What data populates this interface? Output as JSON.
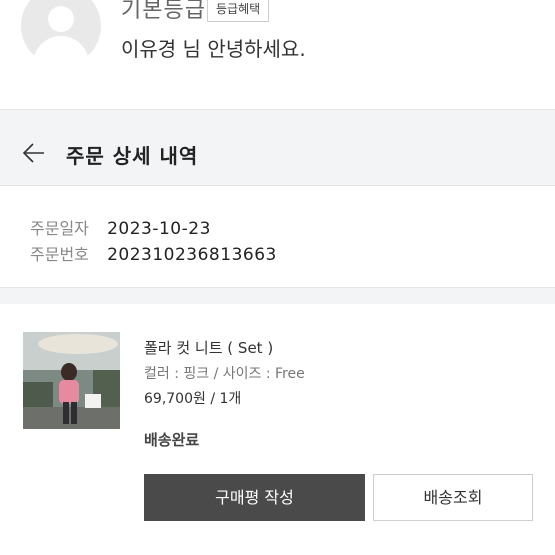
{
  "profile": {
    "grade_label": "기본등급",
    "grade_badge": "등급혜택",
    "greeting": "이유경 님 안녕하세요."
  },
  "header": {
    "title": "주문 상세 내역"
  },
  "order_info": {
    "date_label": "주문일자",
    "date_value": "2023-10-23",
    "number_label": "주문번호",
    "number_value": "20231023681366​3"
  },
  "item": {
    "name": "폴라 컷 니트 ( Set )",
    "options": "컬러 : 핑크 / 사이즈 : Free",
    "price": "69,700원 / 1개",
    "status": "배송완료",
    "review_button": "구매평 작성",
    "track_button": "배송조회"
  },
  "colors": {
    "band": "#f3f4f6",
    "primary_button": "#4a4a4a"
  }
}
